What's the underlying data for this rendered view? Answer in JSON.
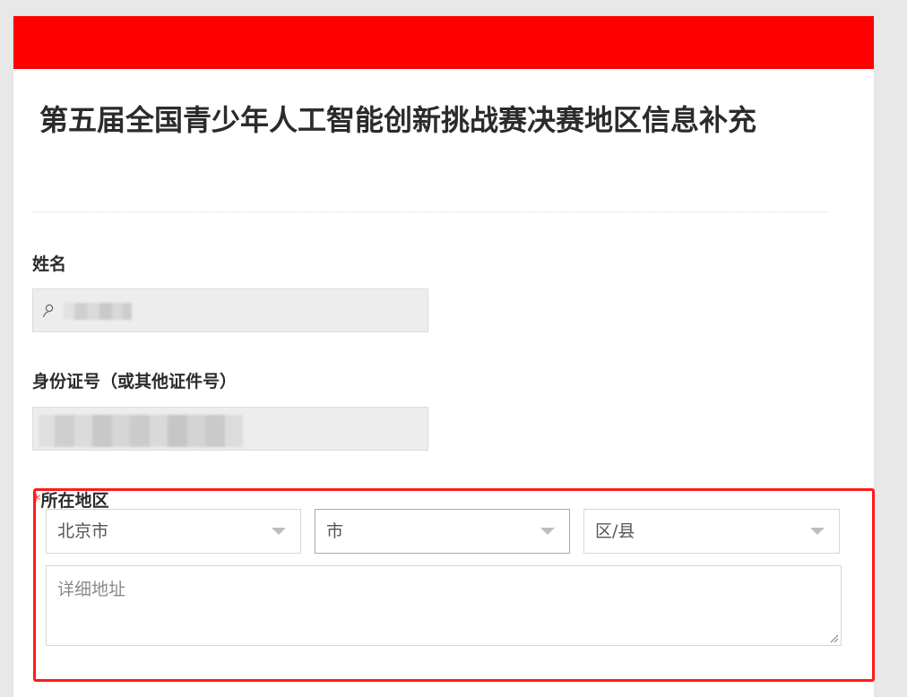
{
  "form": {
    "title": "第五届全国青少年人工智能创新挑战赛决赛地区信息补充"
  },
  "fields": {
    "name": {
      "label": "姓名"
    },
    "id_number": {
      "label": "身份证号（或其他证件号）"
    },
    "region": {
      "required_mark": "*",
      "label": "所在地区",
      "province": "北京市",
      "city": "市",
      "district": "区/县",
      "address_placeholder": "详细地址"
    }
  },
  "icons": {
    "name_field": "user-icon",
    "select_caret": "caret-down-icon",
    "resize": "resize-handle-icon"
  },
  "colors": {
    "header": "#ff0000",
    "required": "#ff3b3b",
    "highlight": "#ff1a1a",
    "input_bg": "#ededed"
  }
}
